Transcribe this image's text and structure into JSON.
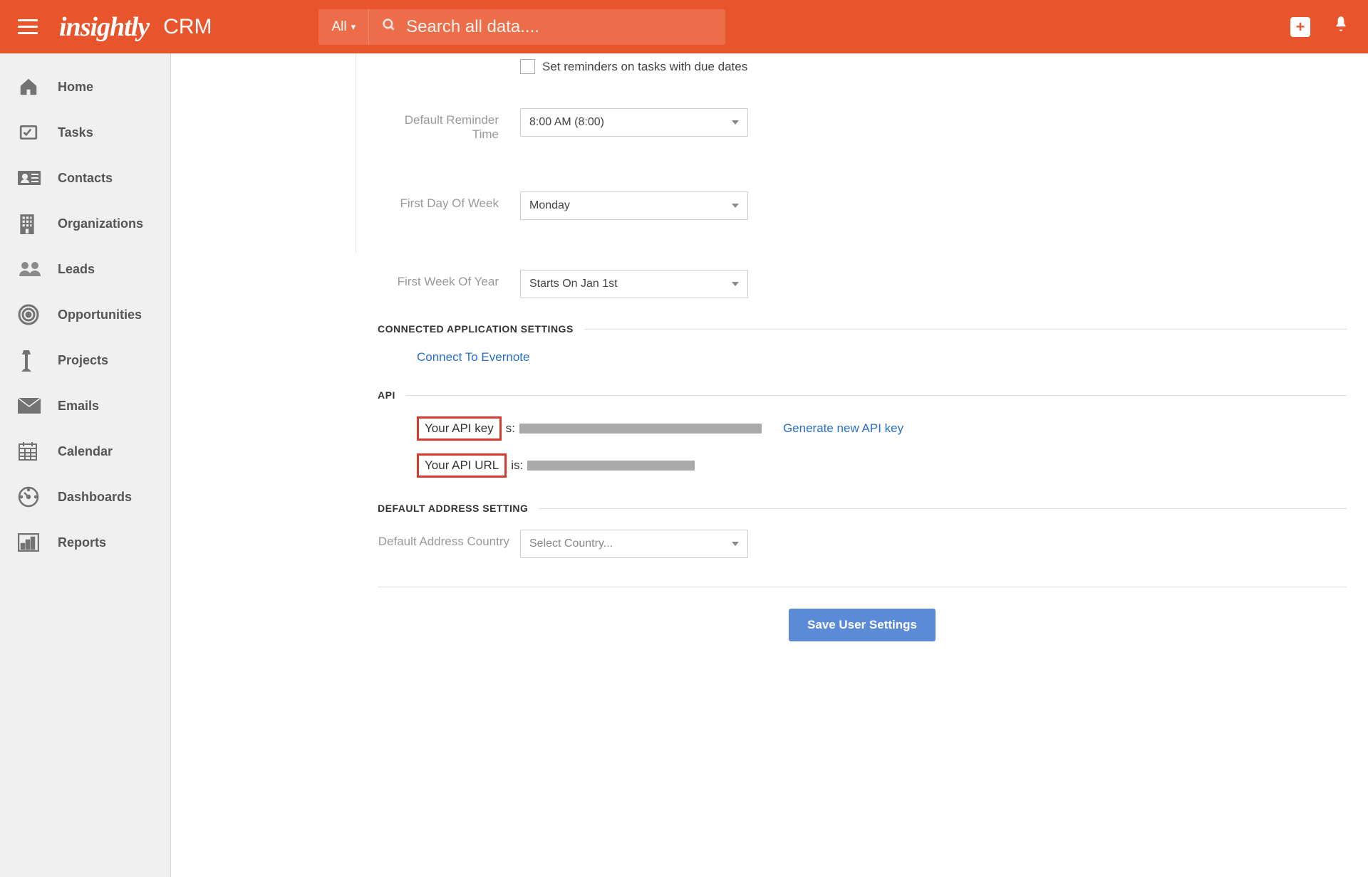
{
  "header": {
    "logo": "insightly",
    "product_label": "CRM",
    "search_filter": "All",
    "search_placeholder": "Search all data...."
  },
  "sidebar": {
    "items": [
      {
        "label": "Home"
      },
      {
        "label": "Tasks"
      },
      {
        "label": "Contacts"
      },
      {
        "label": "Organizations"
      },
      {
        "label": "Leads"
      },
      {
        "label": "Opportunities"
      },
      {
        "label": "Projects"
      },
      {
        "label": "Emails"
      },
      {
        "label": "Calendar"
      },
      {
        "label": "Dashboards"
      },
      {
        "label": "Reports"
      }
    ]
  },
  "settings": {
    "reminder_checkbox_label": "Set reminders on tasks with due dates",
    "default_reminder_label": "Default Reminder Time",
    "default_reminder_value": "8:00 AM (8:00)",
    "first_day_label": "First Day Of Week",
    "first_day_value": "Monday",
    "first_week_label": "First Week Of Year",
    "first_week_value": "Starts On Jan 1st",
    "connected_section": "CONNECTED APPLICATION SETTINGS",
    "evernote_link": "Connect To Evernote",
    "api_section": "API",
    "api_key_label": "Your API key",
    "api_url_label": "Your API URL",
    "is_suffix": "s:",
    "is_suffix2": "is:",
    "generate_link": "Generate new API key",
    "default_address_section": "DEFAULT ADDRESS SETTING",
    "default_address_label": "Default Address Country",
    "default_address_placeholder": "Select Country...",
    "save_button": "Save User Settings"
  }
}
